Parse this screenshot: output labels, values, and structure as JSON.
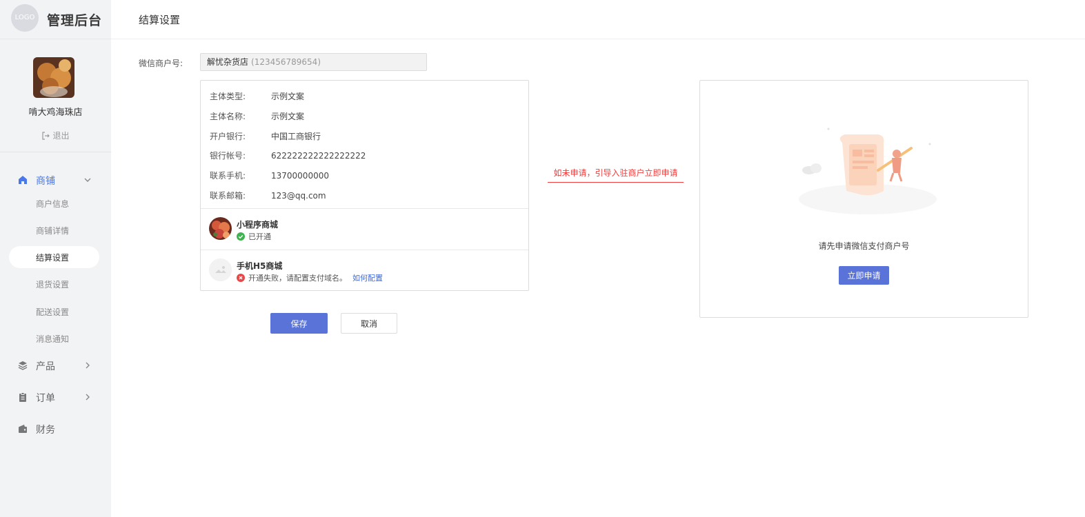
{
  "brand": {
    "logo_text": "LOGO",
    "title": "管理后台"
  },
  "store": {
    "name": "啃大鸡海珠店",
    "logout_label": "退出"
  },
  "nav": {
    "shop": {
      "label": "商铺"
    },
    "sub_items": [
      "商户信息",
      "商铺详情",
      "结算设置",
      "退货设置",
      "配送设置",
      "消息通知"
    ],
    "product": {
      "label": "产品"
    },
    "order": {
      "label": "订单"
    },
    "finance": {
      "label": "财务"
    }
  },
  "page": {
    "title": "结算设置"
  },
  "merchant": {
    "label": "微信商户号:",
    "name": "解忧杂货店",
    "id": "(123456789654)"
  },
  "info": {
    "rows": [
      {
        "label": "主体类型:",
        "value": "示例文案"
      },
      {
        "label": "主体名称:",
        "value": "示例文案"
      },
      {
        "label": "开户银行:",
        "value": "中国工商银行"
      },
      {
        "label": "银行帐号:",
        "value": "622222222222222222"
      },
      {
        "label": "联系手机:",
        "value": "13700000000"
      },
      {
        "label": "联系邮箱:",
        "value": "123@qq.com"
      }
    ]
  },
  "mini_program": {
    "name": "小程序商城",
    "status": "已开通"
  },
  "h5_shop": {
    "name": "手机H5商城",
    "status": "开通失败，请配置支付域名。",
    "link": "如何配置"
  },
  "actions": {
    "save": "保存",
    "cancel": "取消"
  },
  "annotation": "如未申请，引导入驻商户立即申请",
  "apply": {
    "text": "请先申请微信支付商户号",
    "button": "立即申请"
  },
  "colors": {
    "primary": "#5a73d8",
    "active_nav": "#4a78e8",
    "annotation": "#f03c3c",
    "success": "#3fb34f",
    "error": "#e84848"
  }
}
